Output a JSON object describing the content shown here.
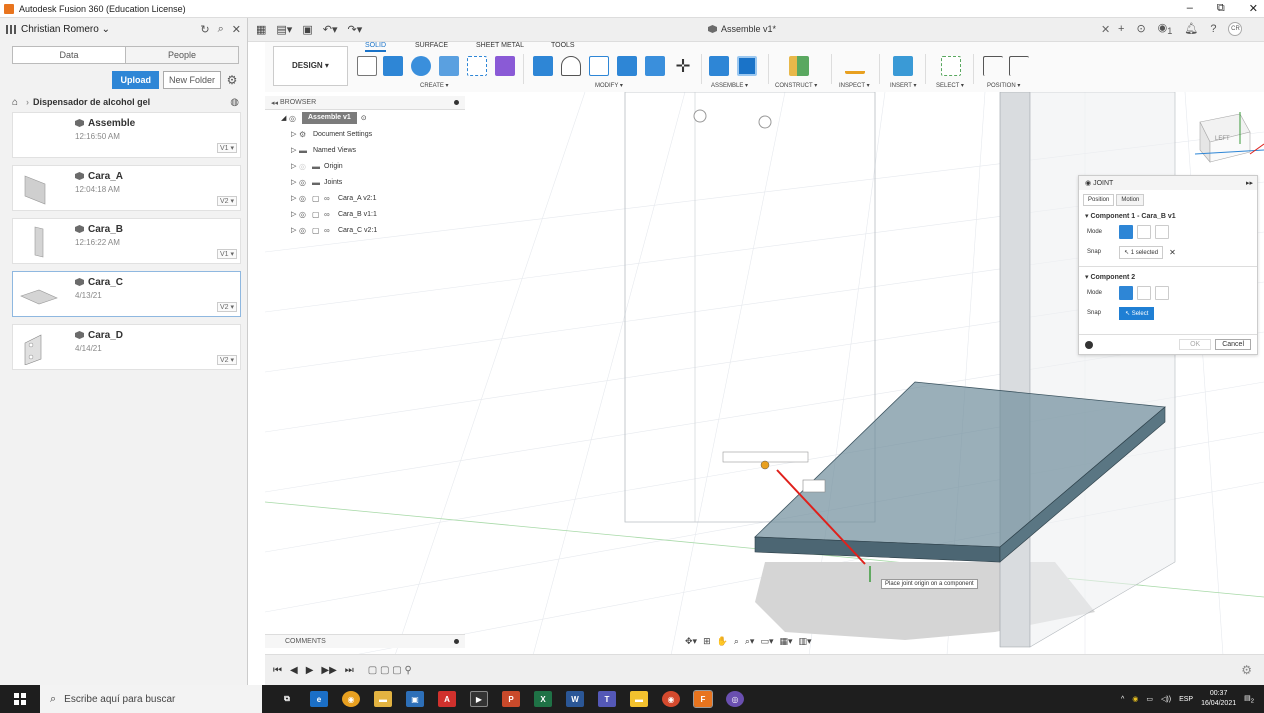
{
  "window": {
    "title": "Autodesk Fusion 360 (Education License)",
    "controls": [
      "–",
      "⧉",
      "✕"
    ]
  },
  "datapanel": {
    "user": "Christian Romero",
    "tabs": [
      "Data",
      "People"
    ],
    "upload_label": "Upload",
    "newfolder_label": "New Folder",
    "crumb": "Dispensador de alcohol gel",
    "files": [
      {
        "name": "Assemble",
        "date": "12:16:50 AM",
        "version": "V1 ▾"
      },
      {
        "name": "Cara_A",
        "date": "12:04:18 AM",
        "version": "V2 ▾"
      },
      {
        "name": "Cara_B",
        "date": "12:16:22 AM",
        "version": "V1 ▾"
      },
      {
        "name": "Cara_C",
        "date": "4/13/21",
        "version": "V2 ▾"
      },
      {
        "name": "Cara_D",
        "date": "4/14/21",
        "version": "V2 ▾"
      }
    ]
  },
  "apphdr": {
    "doc_title": "Assemble v1*",
    "avatar": "CR",
    "notifications": "1"
  },
  "ribbon": {
    "design_label": "DESIGN ▾",
    "tabs": [
      "SOLID",
      "SURFACE",
      "SHEET METAL",
      "TOOLS"
    ],
    "groups": [
      "CREATE ▾",
      "MODIFY ▾",
      "ASSEMBLE ▾",
      "CONSTRUCT ▾",
      "INSPECT ▾",
      "INSERT ▾",
      "SELECT ▾",
      "POSITION ▾"
    ]
  },
  "browser": {
    "title": "BROWSER",
    "root": "Assemble v1",
    "items": [
      "Document Settings",
      "Named Views",
      "Origin",
      "Joints",
      "Cara_A v2:1",
      "Cara_B v1:1",
      "Cara_C v2:1"
    ]
  },
  "comments": {
    "title": "COMMENTS"
  },
  "viewcube": {
    "face": "LEFT"
  },
  "joint": {
    "title": "JOINT",
    "tabs": [
      "Position",
      "Motion"
    ],
    "comp1": "Component 1 - Cara_B v1",
    "comp2": "Component 2",
    "mode_label": "Mode",
    "snap_label": "Snap",
    "snap1_value": "1 selected",
    "snap2_value": "Select",
    "ok_label": "OK",
    "cancel_label": "Cancel"
  },
  "tooltip": "Place joint origin on a component",
  "taskbar": {
    "search_placeholder": "Escribe aquí para buscar",
    "lang": "ESP",
    "time": "00:37",
    "date": "16/04/2021",
    "notif_count": "2"
  },
  "colors": {
    "accent": "#2e86d6",
    "fusion_orange": "#e8741e",
    "model_fill": "#5f7f8f",
    "joint_line": "#e0201b"
  }
}
